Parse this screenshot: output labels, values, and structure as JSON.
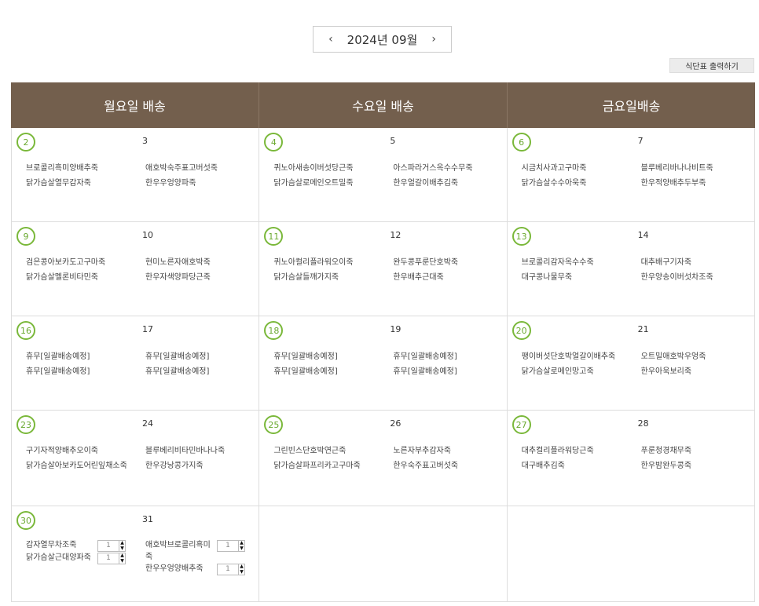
{
  "nav": {
    "prev": "‹",
    "month": "2024년 09월",
    "next": "›"
  },
  "print_label": "식단표 출력하기",
  "columns": [
    "월요일 배송",
    "수요일 배송",
    "금요일배송"
  ],
  "weeks": [
    [
      {
        "d1": "2",
        "d2": "3",
        "a": [
          "브로콜리흑미양배추죽",
          "닭가슴살열무감자죽"
        ],
        "b": [
          "애호박숙주표고버섯죽",
          "한우우엉양파죽"
        ]
      },
      {
        "d1": "4",
        "d2": "5",
        "a": [
          "퀴노아새송이버섯당근죽",
          "닭가슴살로메인오트밀죽"
        ],
        "b": [
          "아스파라거스옥수수무죽",
          "한우얼갈이배추김죽"
        ]
      },
      {
        "d1": "6",
        "d2": "7",
        "a": [
          "시금치사과고구마죽",
          "닭가슴살수수아욱죽"
        ],
        "b": [
          "블루베리바나나비트죽",
          "한우적양배추두부죽"
        ]
      }
    ],
    [
      {
        "d1": "9",
        "d2": "10",
        "a": [
          "검은콩아보카도고구마죽",
          "닭가슴살멜론비타민죽"
        ],
        "b": [
          "현미노른자애호박죽",
          "한우자색양파당근죽"
        ]
      },
      {
        "d1": "11",
        "d2": "12",
        "a": [
          "퀴노아컬리플라워오이죽",
          "닭가슴살들깨가지죽"
        ],
        "b": [
          "완두콩푸룬단호박죽",
          "한우배추근대죽"
        ]
      },
      {
        "d1": "13",
        "d2": "14",
        "a": [
          "브로콜리감자옥수수죽",
          "대구콩나물무죽"
        ],
        "b": [
          "대추배구기자죽",
          "한우양송이버섯차조죽"
        ]
      }
    ],
    [
      {
        "d1": "16",
        "d2": "17",
        "a": [
          "휴무[일괄배송예정]",
          "휴무[일괄배송예정]"
        ],
        "b": [
          "휴무[일괄배송예정]",
          "휴무[일괄배송예정]"
        ]
      },
      {
        "d1": "18",
        "d2": "19",
        "a": [
          "휴무[일괄배송예정]",
          "휴무[일괄배송예정]"
        ],
        "b": [
          "휴무[일괄배송예정]",
          "휴무[일괄배송예정]"
        ]
      },
      {
        "d1": "20",
        "d2": "21",
        "a": [
          "팽이버섯단호박얼갈이배추죽",
          "닭가슴살로메인망고죽"
        ],
        "b": [
          "오트밀애호박우엉죽",
          "한우아욱보리죽"
        ]
      }
    ],
    [
      {
        "d1": "23",
        "d2": "24",
        "a": [
          "구기자적양배추오이죽",
          "닭가슴살아보카도어린잎채소죽"
        ],
        "b": [
          "블루베리비타민바나나죽",
          "한우강낭콩가지죽"
        ]
      },
      {
        "d1": "25",
        "d2": "26",
        "a": [
          "그린빈스단호박연근죽",
          "닭가슴살파프리카고구마죽"
        ],
        "b": [
          "노른자부추감자죽",
          "한우숙주표고버섯죽"
        ]
      },
      {
        "d1": "27",
        "d2": "28",
        "a": [
          "대추컬리플라워당근죽",
          "대구배추김죽"
        ],
        "b": [
          "푸룬청경채무죽",
          "한우밤완두콩죽"
        ]
      }
    ]
  ],
  "last_week": {
    "d1": "30",
    "d2": "31",
    "a": [
      {
        "name": "감자열무차조죽",
        "qty": "1"
      },
      {
        "name": "닭가슴살근대양파죽",
        "qty": "1"
      }
    ],
    "b": [
      {
        "name": "애호박브로콜리흑미죽",
        "qty": "1"
      },
      {
        "name": "한우우엉양배추죽",
        "qty": "1"
      }
    ]
  },
  "stepper": {
    "up": "▲",
    "down": "▼"
  }
}
